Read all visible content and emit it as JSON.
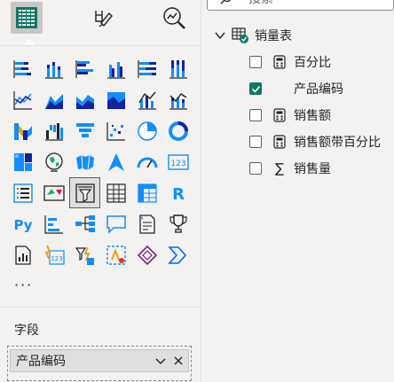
{
  "viz_pane": {
    "tabs": [
      {
        "name": "build-visual",
        "icon": "build-visual-icon",
        "active": true
      },
      {
        "name": "format-visual",
        "icon": "format-brush-icon",
        "active": false
      },
      {
        "name": "analytics",
        "icon": "analytics-magnifier-icon",
        "active": false
      }
    ],
    "visuals": [
      "stacked-bar-chart-icon",
      "stacked-column-chart-icon",
      "clustered-bar-chart-icon",
      "clustered-column-chart-icon",
      "100-stacked-bar-chart-icon",
      "100-stacked-column-chart-icon",
      "",
      "line-chart-icon",
      "area-chart-icon",
      "stacked-area-chart-icon",
      "100-stacked-area-chart-icon",
      "line-clustered-column-icon",
      "line-stacked-column-icon",
      "",
      "ribbon-chart-icon",
      "waterfall-chart-icon",
      "funnel-chart-icon",
      "scatter-chart-icon",
      "pie-chart-icon",
      "donut-chart-icon",
      "",
      "treemap-icon",
      "map-icon",
      "filled-map-icon",
      "azure-map-icon",
      "gauge-icon",
      "card-icon",
      "",
      "multi-row-card-icon",
      "kpi-icon",
      "slicer-icon",
      "table-icon",
      "matrix-icon",
      "r-visual-icon",
      "",
      "python-visual-icon",
      "key-influencers-icon",
      "decomposition-tree-icon",
      "qa-icon",
      "smart-narrative-icon",
      "metrics-trophy-icon",
      "",
      "paginated-report-icon",
      "power-apps-icon",
      "power-automate-icon",
      "custom-visual-icon",
      "power-apps-diamond-icon",
      "power-automate-arrow-icon",
      ""
    ],
    "selected_visual": "slicer-icon",
    "more_label": "···",
    "fields_label": "字段",
    "field_well": {
      "value": "产品编码"
    },
    "r_label": "R",
    "py_label": "Py",
    "card_label": "123"
  },
  "fields_pane": {
    "search_placeholder": "搜索",
    "table": {
      "name": "销量表"
    },
    "fields": [
      {
        "label": "百分比",
        "type": "calculator-icon",
        "checked": false
      },
      {
        "label": "产品编码",
        "type": "",
        "checked": true
      },
      {
        "label": "销售额",
        "type": "calculator-icon",
        "checked": false
      },
      {
        "label": "销售额带百分比",
        "type": "calculator-icon",
        "checked": false
      },
      {
        "label": "销售量",
        "type": "sigma-icon",
        "checked": false
      }
    ],
    "sigma_glyph": "∑"
  },
  "colors": {
    "accent_green": "#117865",
    "viz_blue": "#118dff",
    "viz_teal": "#12239e"
  }
}
